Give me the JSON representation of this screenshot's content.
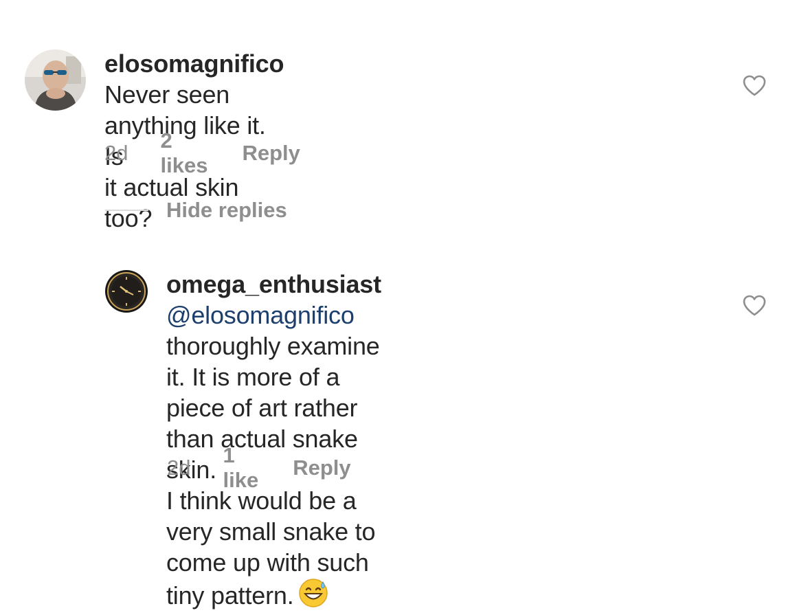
{
  "comments": [
    {
      "username": "elosomagnifico",
      "text_line1": " Never seen anything like it. Is",
      "text_line2": "it actual skin too?",
      "time": "2d",
      "likes": "2 likes",
      "reply": "Reply"
    }
  ],
  "thread": {
    "hide_label": "Hide replies"
  },
  "replies": [
    {
      "username": "omega_enthusiast",
      "mention": "@elosomagnifico",
      "lines": [
        "thoroughly examine it.  It is more of a",
        "piece of art rather than actual snake skin.",
        "I think would be a very small snake to",
        "come up with such tiny pattern."
      ],
      "emoji": "😅",
      "time": "2d",
      "likes": "1 like",
      "reply": "Reply"
    }
  ],
  "colors": {
    "text": "#262626",
    "secondary": "#8e8e8e",
    "mention": "#1c3f6e",
    "divider": "#dbdbdb"
  }
}
